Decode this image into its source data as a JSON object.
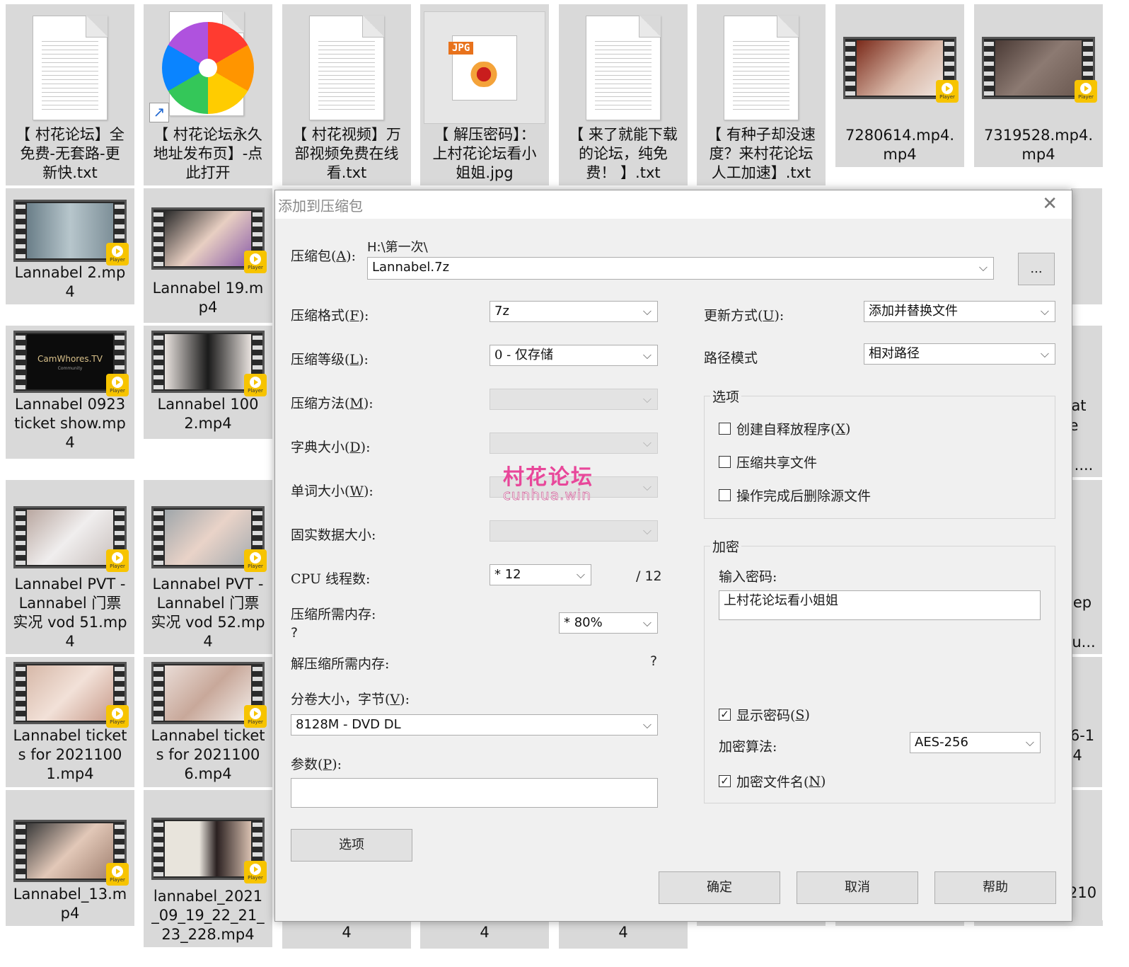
{
  "explorer": {
    "top_row": [
      {
        "label": "【 村花论坛】全免费-无套路-更新快.txt",
        "icon": "text-file-icon"
      },
      {
        "label": "【 村花论坛永久地址发布页】-点此打开",
        "icon": "shortcut-app-icon"
      },
      {
        "label": "【 村花视频】万部视频免费在线看.txt",
        "icon": "text-file-icon"
      },
      {
        "label": "【 解压密码】：上村花论坛看小姐姐.jpg",
        "icon": "jpg-file-icon"
      },
      {
        "label": "【 来了就能下载的论坛，纯免费！ 】.txt",
        "icon": "text-file-icon"
      },
      {
        "label": "【 有种子却没速度？来村花论坛人工加速】.txt",
        "icon": "text-file-icon"
      },
      {
        "label": "7280614.mp4.mp4",
        "icon": "video-file-icon"
      },
      {
        "label": "7319528.mp4.mp4",
        "icon": "video-file-icon"
      }
    ],
    "left_col1": [
      {
        "label": "Lannabel 2.mp4"
      },
      {
        "label": "Lannabel 0923 ticket show.mp4"
      },
      {
        "label": "Lannabel PVT - Lannabel 门票实况 vod 51.mp4"
      },
      {
        "label": "Lannabel tickets for 20211001.mp4"
      },
      {
        "label": "Lannabel_13.mp4"
      }
    ],
    "left_col2": [
      {
        "label": "Lannabel 19.mp4"
      },
      {
        "label": "Lannabel 1002.mp4"
      },
      {
        "label": "Lannabel PVT - Lannabel 门票实况 vod 52.mp4"
      },
      {
        "label": "Lannabel tickets for 20211006.mp4"
      },
      {
        "label": "lannabel_2021_09_19_22_21_23_228.mp4"
      }
    ],
    "right_fragments": [
      "at",
      "e",
      "....",
      "ep",
      "u...",
      "6-1",
      "4",
      "210"
    ],
    "bottom_fragments": [
      "4",
      "4",
      "4"
    ],
    "player_badge": "Player",
    "camwhores_text": "CamWhores.TV",
    "camwhores_sub": "Community",
    "jpg_tag": "JPG"
  },
  "dialog": {
    "title": "添加到压缩包",
    "archive_label": "压缩包(",
    "archive_key": "A",
    "archive_label_end": "):",
    "archive_path": "H:\\第一次\\",
    "archive_name": "Lannabel.7z",
    "browse_label": "...",
    "format_label": "压缩格式(",
    "format_key": "F",
    "format_end": "):",
    "format_value": "7z",
    "level_label": "压缩等级(",
    "level_key": "L",
    "level_end": "):",
    "level_value": "0 - 仅存储",
    "method_label": "压缩方法(",
    "method_key": "M",
    "method_end": "):",
    "dict_label": "字典大小(",
    "dict_key": "D",
    "dict_end": "):",
    "word_label": "单词大小(",
    "word_key": "W",
    "word_end": "):",
    "solid_label": "固实数据大小:",
    "cpu_label": "CPU 线程数:",
    "cpu_value": "* 12",
    "cpu_max": "/ 12",
    "mem_comp_label": "压缩所需内存:",
    "mem_comp_value": "?",
    "mem_comp_percent": "* 80%",
    "mem_decomp_label": "解压缩所需内存:",
    "mem_decomp_value": "?",
    "split_label": "分卷大小，字节(",
    "split_key": "V",
    "split_end": "):",
    "split_value": "8128M - DVD DL",
    "params_label": "参数(",
    "params_key": "P",
    "params_end": "):",
    "params_value": "",
    "options_button": "选项",
    "update_label": "更新方式(",
    "update_key": "U",
    "update_end": "):",
    "update_value": "添加并替换文件",
    "path_mode_label": "路径模式",
    "path_mode_value": "相对路径",
    "options_group": "选项",
    "opt_sfx": "创建自释放程序(",
    "opt_sfx_key": "X",
    "opt_sfx_end": ")",
    "opt_shared": "压缩共享文件",
    "opt_delete": "操作完成后删除源文件",
    "encrypt_group": "加密",
    "password_label": "输入密码:",
    "password_value": "上村花论坛看小姐姐",
    "show_password": "显示密码(",
    "show_password_key": "S",
    "show_password_end": ")",
    "algo_label": "加密算法:",
    "algo_value": "AES-256",
    "encrypt_names": "加密文件名(",
    "encrypt_names_key": "N",
    "encrypt_names_end": ")",
    "ok": "确定",
    "cancel": "取消",
    "help": "帮助",
    "checked_mark": "✓",
    "close_glyph": "✕",
    "dropdown_glyph": "⌵"
  },
  "watermark": {
    "cn": "村花论坛",
    "en": "cunhua.win"
  },
  "colors": {
    "tile_bg": "#d9d9d9",
    "dialog_bg": "#f0f0f0",
    "player_yellow": "#f7c400",
    "watermark_pink": "#e8479a"
  }
}
